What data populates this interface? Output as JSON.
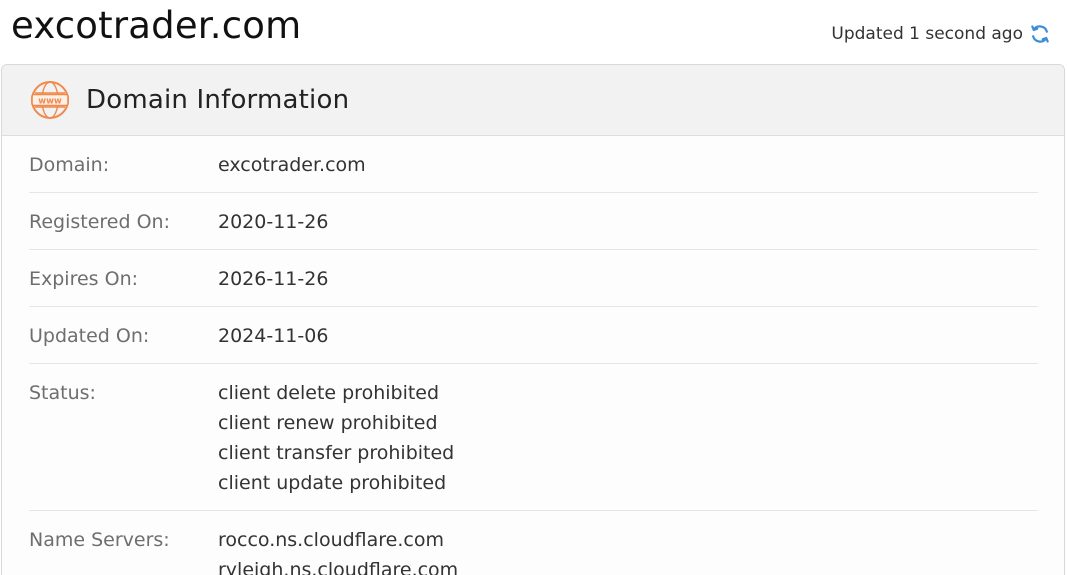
{
  "header": {
    "site": "excotrader.com",
    "updated_text": "Updated 1 second ago",
    "refresh_icon": "refresh-icon",
    "accent_color": "#3a8edb"
  },
  "card": {
    "icon": "www-globe-icon",
    "icon_text": "www",
    "icon_color": "#f0894b",
    "title": "Domain Information",
    "rows": [
      {
        "label": "Domain:",
        "values": [
          "excotrader.com"
        ]
      },
      {
        "label": "Registered On:",
        "values": [
          "2020-11-26"
        ]
      },
      {
        "label": "Expires On:",
        "values": [
          "2026-11-26"
        ]
      },
      {
        "label": "Updated On:",
        "values": [
          "2024-11-06"
        ]
      },
      {
        "label": "Status:",
        "values": [
          "client delete prohibited",
          "client renew prohibited",
          "client transfer prohibited",
          "client update prohibited"
        ]
      },
      {
        "label": "Name Servers:",
        "values": [
          "rocco.ns.cloudflare.com",
          "ryleigh.ns.cloudflare.com"
        ]
      }
    ]
  }
}
